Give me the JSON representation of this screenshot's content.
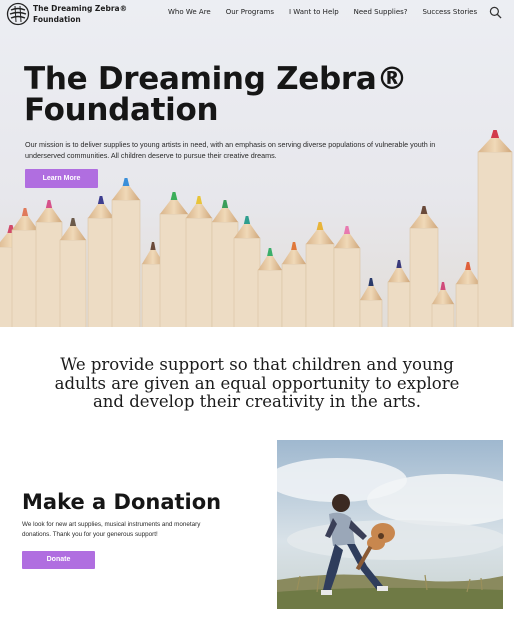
{
  "nav": {
    "brand": "The Dreaming Zebra®\nFoundation",
    "links": [
      "Who We Are",
      "Our Programs",
      "I Want to Help",
      "Need Supplies?",
      "Success Stories"
    ]
  },
  "hero": {
    "title": "The Dreaming Zebra®\nFoundation",
    "description": "Our mission is to deliver supplies to young artists in need, with an emphasis on serving diverse populations of vulnerable youth in underserved communities.  All children deserve to pursue their creative dreams.",
    "button_label": "Learn More"
  },
  "mission": {
    "text": "We provide support so that children and young adults are given an equal opportunity to explore and develop their creativity in the arts."
  },
  "donation": {
    "title": "Make a Donation",
    "text": "We look for new art supplies, musical instruments and monetary donations. Thank you for your generous support!",
    "button_label": "Donate"
  },
  "colors": {
    "accent": "#b06ee0"
  },
  "icons": {
    "logo": "zebra-logo-icon",
    "search": "search-icon"
  }
}
